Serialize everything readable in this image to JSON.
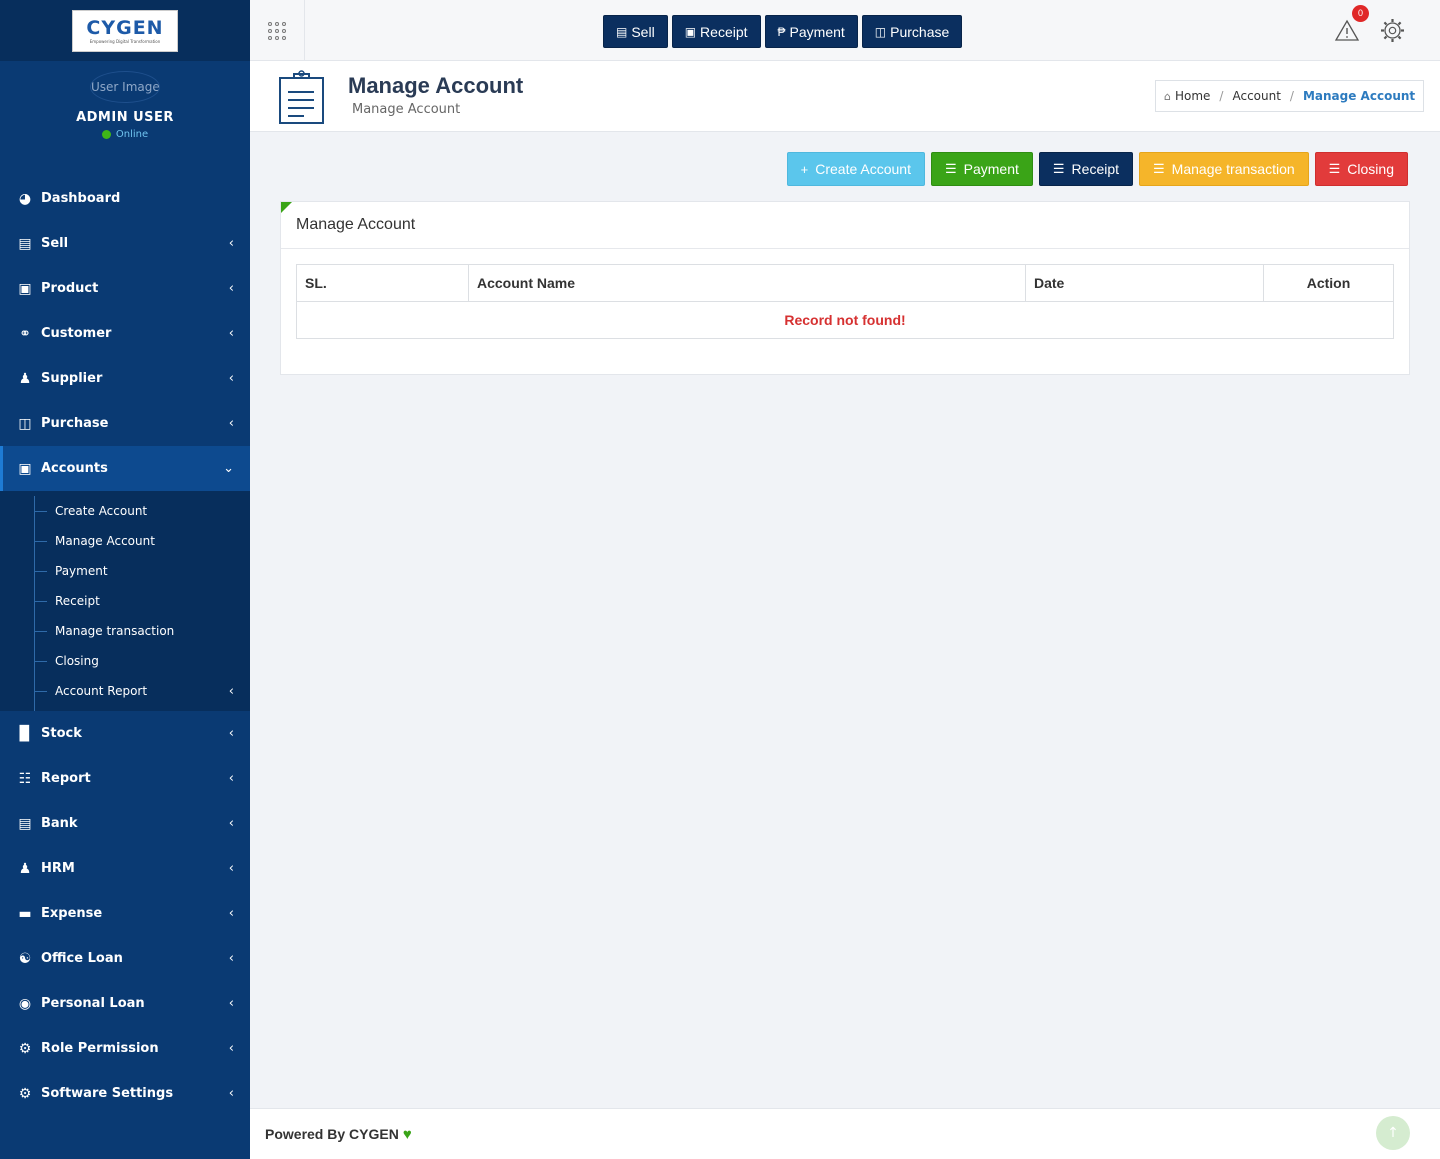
{
  "brand": {
    "logo_text": "CYGEN",
    "logo_tagline": "Empowering Digital Transformation"
  },
  "user": {
    "avatar_alt": "User Image",
    "name": "ADMIN USER",
    "status": "Online"
  },
  "sidebar": {
    "items": [
      {
        "label": "Dashboard",
        "icon": "dashboard-icon"
      },
      {
        "label": "Sell",
        "icon": "sell-icon"
      },
      {
        "label": "Product",
        "icon": "product-icon"
      },
      {
        "label": "Customer",
        "icon": "handshake-icon"
      },
      {
        "label": "Supplier",
        "icon": "user-icon"
      },
      {
        "label": "Purchase",
        "icon": "cart-icon"
      },
      {
        "label": "Accounts",
        "icon": "money-icon"
      },
      {
        "label": "Stock",
        "icon": "bar-chart-icon"
      },
      {
        "label": "Report",
        "icon": "book-icon"
      },
      {
        "label": "Bank",
        "icon": "briefcase-icon"
      },
      {
        "label": "HRM",
        "icon": "person-icon"
      },
      {
        "label": "Expense",
        "icon": "credit-card-icon"
      },
      {
        "label": "Office Loan",
        "icon": "bank-icon"
      },
      {
        "label": "Personal Loan",
        "icon": "user-circle-icon"
      },
      {
        "label": "Role Permission",
        "icon": "gear-icon"
      },
      {
        "label": "Software Settings",
        "icon": "gear-icon"
      }
    ],
    "accounts_sub": [
      {
        "label": "Create Account"
      },
      {
        "label": "Manage Account"
      },
      {
        "label": "Payment"
      },
      {
        "label": "Receipt"
      },
      {
        "label": "Manage transaction"
      },
      {
        "label": "Closing"
      },
      {
        "label": "Account Report"
      }
    ]
  },
  "topbar": {
    "quick_buttons": [
      {
        "label": "Sell",
        "icon": "sell-icon"
      },
      {
        "label": "Receipt",
        "icon": "money-icon"
      },
      {
        "label": "Payment",
        "icon": "paypal-icon"
      },
      {
        "label": "Purchase",
        "icon": "cart-icon"
      }
    ],
    "notification_count": "0"
  },
  "page": {
    "title": "Manage Account",
    "subtitle": "Manage Account",
    "breadcrumb": {
      "home": "Home",
      "parent": "Account",
      "current": "Manage Account"
    }
  },
  "actions": {
    "create": "Create Account",
    "payment": "Payment",
    "receipt": "Receipt",
    "manage": "Manage transaction",
    "closing": "Closing"
  },
  "panel": {
    "heading": "Manage Account",
    "columns": [
      "SL.",
      "Account Name",
      "Date",
      "Action"
    ],
    "empty_message": "Record not found!"
  },
  "footer": {
    "text": "Powered By CYGEN"
  },
  "colors": {
    "sidebar_bg": "#0a3a73",
    "navy": "#0b2f5f",
    "info": "#5bc6ec",
    "success": "#3aa417",
    "warning": "#f5b52a",
    "danger": "#e23b3b"
  }
}
